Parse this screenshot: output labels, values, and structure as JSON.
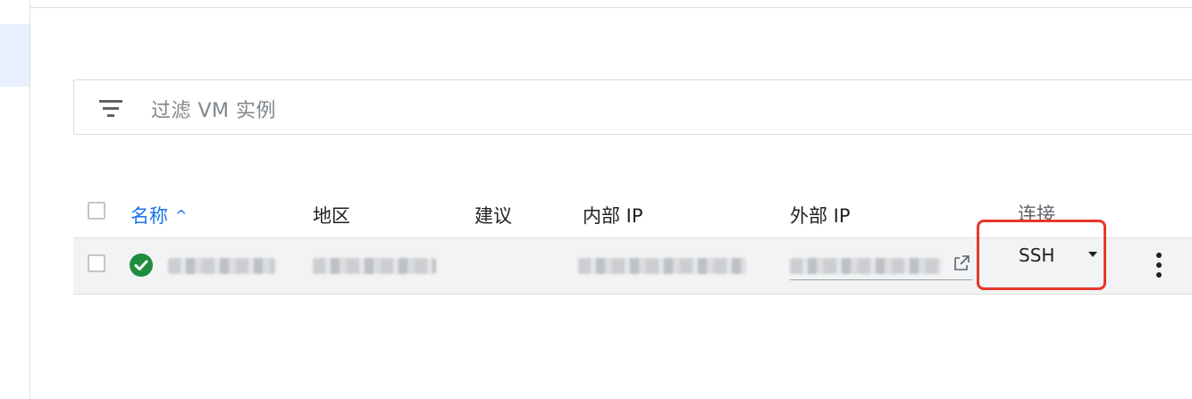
{
  "filter": {
    "placeholder": "过滤 VM 实例",
    "icon": "filter-icon"
  },
  "table": {
    "columns": [
      "名称",
      "地区",
      "建议",
      "内部 IP",
      "外部 IP",
      "连接"
    ],
    "sort_indicator": "^",
    "rows": [
      {
        "status": "running",
        "name": "",
        "zone": "",
        "recommendation": "",
        "internal_ip": "",
        "external_ip": "",
        "connect": "SSH"
      }
    ]
  },
  "colors": {
    "primary": "#1a73e8",
    "status_ok": "#1e8e3e",
    "highlight": "#e8372a",
    "row_bg": "#f1f3f4"
  }
}
